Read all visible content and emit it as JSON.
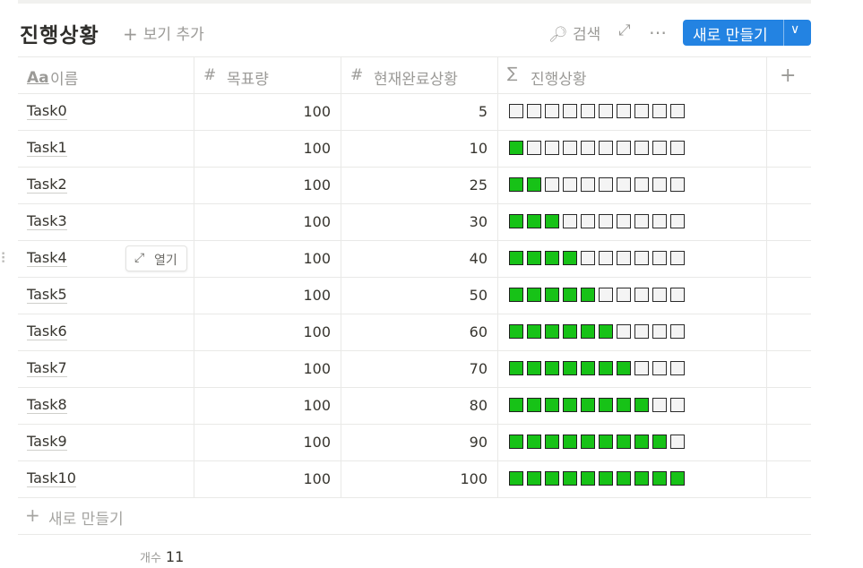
{
  "header": {
    "title": "진행상황",
    "add_view_label": "보기 추가",
    "search_label": "검색",
    "new_button_label": "새로 만들기"
  },
  "columns": [
    {
      "icon": "text-property-icon",
      "label": "이름"
    },
    {
      "icon": "number-property-icon",
      "label": "목표량"
    },
    {
      "icon": "number-property-icon",
      "label": "현재완료상황"
    },
    {
      "icon": "formula-property-icon",
      "label": "진행상황"
    }
  ],
  "rows": [
    {
      "name": "Task0",
      "target": "100",
      "done": "5",
      "progress_filled": 0,
      "progress_total": 10
    },
    {
      "name": "Task1",
      "target": "100",
      "done": "10",
      "progress_filled": 1,
      "progress_total": 10
    },
    {
      "name": "Task2",
      "target": "100",
      "done": "25",
      "progress_filled": 2,
      "progress_total": 10
    },
    {
      "name": "Task3",
      "target": "100",
      "done": "30",
      "progress_filled": 3,
      "progress_total": 10
    },
    {
      "name": "Task4",
      "target": "100",
      "done": "40",
      "progress_filled": 4,
      "progress_total": 10
    },
    {
      "name": "Task5",
      "target": "100",
      "done": "50",
      "progress_filled": 5,
      "progress_total": 10
    },
    {
      "name": "Task6",
      "target": "100",
      "done": "60",
      "progress_filled": 6,
      "progress_total": 10
    },
    {
      "name": "Task7",
      "target": "100",
      "done": "70",
      "progress_filled": 7,
      "progress_total": 10
    },
    {
      "name": "Task8",
      "target": "100",
      "done": "80",
      "progress_filled": 8,
      "progress_total": 10
    },
    {
      "name": "Task9",
      "target": "100",
      "done": "90",
      "progress_filled": 9,
      "progress_total": 10
    },
    {
      "name": "Task10",
      "target": "100",
      "done": "100",
      "progress_filled": 10,
      "progress_total": 10
    }
  ],
  "open_button_label": "열기",
  "hovered_row_index": 4,
  "new_row_label": "새로 만들기",
  "footer": {
    "count_label": "개수",
    "count_value": "11"
  },
  "colors": {
    "accent": "#2383e2",
    "progress_filled": "#17c217",
    "progress_empty": "#f4f4f4"
  }
}
